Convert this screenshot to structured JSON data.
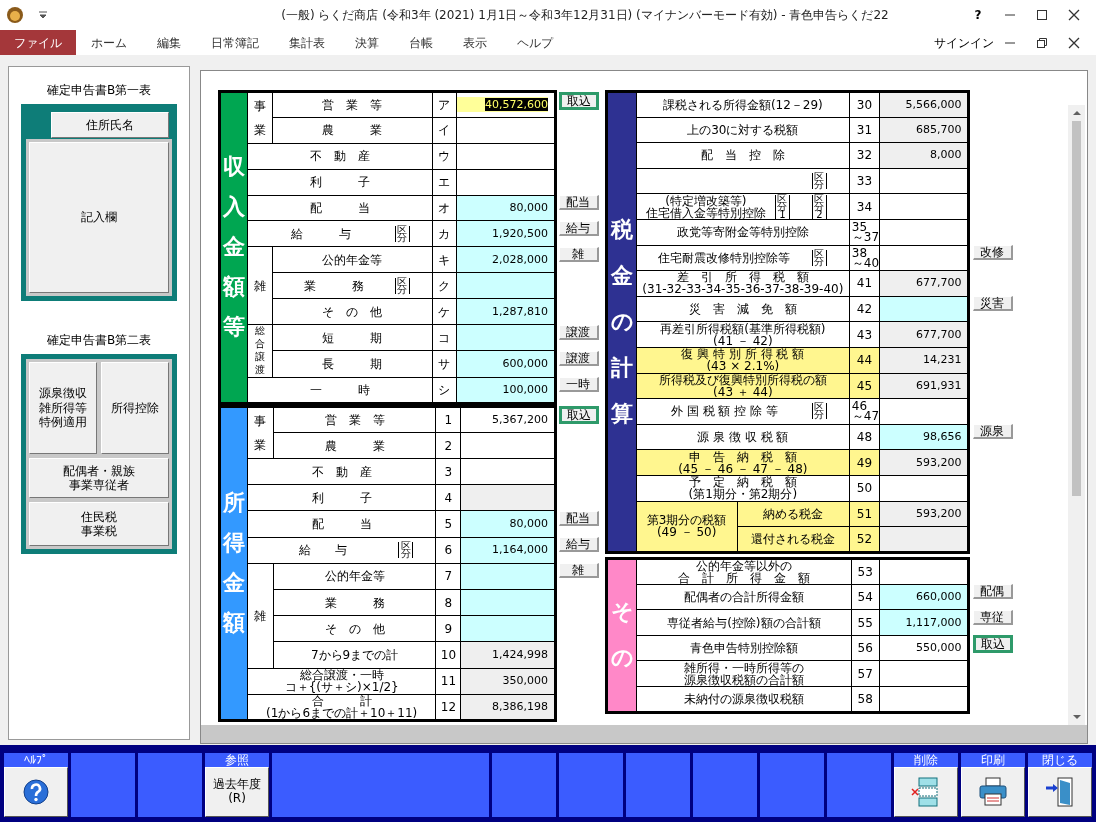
{
  "window": {
    "title": "(一般) らくだ商店 (令和3年 (2021) 1月1日～令和3年12月31日) (マイナンバーモード有効)  - 青色申告らくだ22",
    "help": "?"
  },
  "menu": {
    "tabs": [
      {
        "label": "ファイル",
        "selected": true
      },
      {
        "label": "ホーム",
        "selected": false
      },
      {
        "label": "編集",
        "selected": false
      },
      {
        "label": "日常簿記",
        "selected": false
      },
      {
        "label": "集計表",
        "selected": false
      },
      {
        "label": "決算",
        "selected": false
      },
      {
        "label": "台帳",
        "selected": false
      },
      {
        "label": "表示",
        "selected": false
      },
      {
        "label": "ヘルプ",
        "selected": false
      }
    ],
    "signin": "サインイン"
  },
  "side_panels": [
    {
      "title": "確定申告書B第一表",
      "buttons": [
        {
          "lines": [
            "住所氏名"
          ]
        },
        {
          "lines": [
            "記入欄"
          ]
        }
      ]
    },
    {
      "title": "確定申告書B第二表",
      "buttons": [
        {
          "lines": [
            "源泉徴収",
            "雑所得等",
            "特例適用"
          ]
        },
        {
          "lines": [
            "所得控除"
          ]
        },
        {
          "lines": [
            "配偶者・親族",
            "事業専従者"
          ]
        },
        {
          "lines": [
            "住民税",
            "事業税"
          ]
        }
      ]
    }
  ],
  "left_sections": [
    {
      "title": "収入金額等",
      "color": "#00a651",
      "rows": [
        {
          "label": "事業",
          "children": [
            {
              "label": "営　業　等",
              "code": "ア",
              "value": "40,572,600",
              "kind": "focused",
              "button": {
                "label": "取込",
                "kind": "highlight"
              }
            },
            {
              "label": "農　　　業",
              "code": "イ",
              "kind": "plain"
            }
          ]
        },
        {
          "label": "不　動　産",
          "code": "ウ",
          "kind": "plain"
        },
        {
          "label": "利　　　子",
          "code": "エ",
          "kind": "plain"
        },
        {
          "label": "配　　　当",
          "code": "オ",
          "value": "80,000",
          "kind": "input",
          "button": {
            "label": "配当",
            "kind": "plain"
          }
        },
        {
          "label": "給　　　与",
          "kubun": [
            "区分"
          ],
          "code": "カ",
          "value": "1,920,500",
          "kind": "input",
          "button": {
            "label": "給与",
            "kind": "plain"
          }
        },
        {
          "label": "雑",
          "button": {
            "label": "雑",
            "kind": "plain"
          },
          "children": [
            {
              "label": "公的年金等",
              "code": "キ",
              "value": "2,028,000",
              "kind": "input"
            },
            {
              "label": "業　　　務",
              "kubun": [
                "区分"
              ],
              "code": "ク",
              "kind": "input"
            },
            {
              "label": "そ　の　他",
              "code": "ケ",
              "value": "1,287,810",
              "kind": "input"
            }
          ]
        },
        {
          "label": "総合譲渡",
          "children": [
            {
              "label": "短　　　期",
              "code": "コ",
              "kind": "input",
              "button": {
                "label": "譲渡",
                "kind": "plain"
              }
            },
            {
              "label": "長　　　期",
              "code": "サ",
              "value": "600,000",
              "kind": "input",
              "button": {
                "label": "譲渡",
                "kind": "plain"
              }
            }
          ]
        },
        {
          "label": "一　　　時",
          "code": "シ",
          "value": "100,000",
          "kind": "input",
          "button": {
            "label": "一時",
            "kind": "plain"
          }
        }
      ]
    },
    {
      "title": "所得金額",
      "color": "#3399ff",
      "rows": [
        {
          "label": "事業",
          "children": [
            {
              "label": "営　業　等",
              "code": "1",
              "value": "5,367,200",
              "kind": "plain",
              "button": {
                "label": "取込",
                "kind": "highlight"
              }
            },
            {
              "label": "農　　　業",
              "code": "2",
              "kind": "plain"
            }
          ]
        },
        {
          "label": "不　動　産",
          "code": "3",
          "kind": "plain"
        },
        {
          "label": "利　　　子",
          "code": "4",
          "kind": "calc"
        },
        {
          "label": "配　　　当",
          "code": "5",
          "value": "80,000",
          "kind": "input",
          "button": {
            "label": "配当",
            "kind": "plain"
          }
        },
        {
          "label": "給　　与",
          "kubun": [
            "区分"
          ],
          "code": "6",
          "value": "1,164,000",
          "kind": "input",
          "button": {
            "label": "給与",
            "kind": "plain"
          }
        },
        {
          "label": "雑",
          "button": {
            "label": "雑",
            "kind": "plain"
          },
          "children": [
            {
              "label": "公的年金等",
              "code": "7",
              "kind": "input"
            },
            {
              "label": "業　　　務",
              "code": "8",
              "kind": "input"
            },
            {
              "label": "そ　の　他",
              "code": "9",
              "kind": "input"
            },
            {
              "label": "7から9までの計",
              "code": "10",
              "value": "1,424,998",
              "kind": "calc"
            }
          ]
        },
        {
          "label": "総合譲渡・一時",
          "note": "コ＋{(サ＋シ)×1/2}",
          "code": "11",
          "value": "350,000",
          "kind": "calc"
        },
        {
          "label": "合　　　計",
          "note": "(1から6までの計＋10＋11)",
          "code": "12",
          "value": "8,386,198",
          "kind": "calc"
        }
      ]
    }
  ],
  "right_sections": [
    {
      "title": "税金の計算",
      "color": "#2e3192",
      "rows": [
        {
          "label": "課税される所得金額(12－29)",
          "code": "30",
          "value": "5,566,000",
          "kind": "calc",
          "highlight": false
        },
        {
          "label": "上の30に対する税額",
          "code": "31",
          "value": "685,700",
          "kind": "calc",
          "highlight": false
        },
        {
          "label": "配　当　控　除",
          "code": "32",
          "value": "8,000",
          "kind": "calc",
          "highlight": false
        },
        {
          "kubun": [
            "区分"
          ],
          "code": "33",
          "kind": "plain",
          "highlight": false
        },
        {
          "label": "(特定増改築等)",
          "note": "住宅借入金等特別控除",
          "kubun": [
            "区分1",
            "区分2"
          ],
          "code": "34",
          "kind": "plain",
          "highlight": false
        },
        {
          "label": "政党等寄附金等特別控除",
          "code": "35～37",
          "kind": "plain",
          "highlight": false
        },
        {
          "label": "住宅耐震改修特別控除等",
          "kubun": [
            "区分"
          ],
          "code": "38～40",
          "kind": "plain",
          "highlight": false,
          "button": {
            "label": "改修",
            "kind": "plain"
          }
        },
        {
          "label": "差　引　所　得　税　額",
          "note": "(31-32-33-34-35-36-37-38-39-40)",
          "code": "41",
          "value": "677,700",
          "kind": "calc",
          "highlight": false
        },
        {
          "label": "災　害　減　免　額",
          "code": "42",
          "kind": "input",
          "highlight": false,
          "button": {
            "label": "災害",
            "kind": "plain"
          }
        },
        {
          "label": "再差引所得税額(基準所得税額)",
          "note": "(41 － 42)",
          "code": "43",
          "value": "677,700",
          "kind": "calc",
          "highlight": false
        },
        {
          "label": "復 興 特 別 所 得 税 額",
          "note": "(43 × 2.1%)",
          "code": "44",
          "value": "14,231",
          "kind": "calc",
          "highlight": true
        },
        {
          "label": "所得税及び復興特別所得税の額",
          "note": "(43 ＋ 44)",
          "code": "45",
          "value": "691,931",
          "kind": "calc",
          "highlight": true
        },
        {
          "label": "外 国 税 額 控 除 等",
          "kubun": [
            "区分"
          ],
          "code": "46～47",
          "kind": "plain",
          "highlight": false
        },
        {
          "label": "源 泉 徴 収 税 額",
          "code": "48",
          "value": "98,656",
          "kind": "input",
          "highlight": false,
          "button": {
            "label": "源泉",
            "kind": "plain"
          }
        },
        {
          "label": "申　告　納　税　額",
          "note": "(45 － 46 － 47 － 48)",
          "code": "49",
          "value": "593,200",
          "kind": "calc",
          "highlight": true
        },
        {
          "label": "予　定　納　税　額",
          "note": "(第1期分・第2期分)",
          "code": "50",
          "kind": "plain",
          "highlight": false
        },
        {
          "label": "第3期分の税額",
          "note": "(49 － 50)",
          "highlight": true,
          "children": [
            {
              "label": "納める税金",
              "code": "51",
              "value": "593,200",
              "kind": "calc",
              "highlight": true
            },
            {
              "label": "還付される税金",
              "code": "52",
              "kind": "calc",
              "highlight": true
            }
          ]
        }
      ]
    },
    {
      "title": "その",
      "color": "#ff88c8",
      "rows": [
        {
          "label": "公的年金等以外の",
          "note": "合　計　所　得　金　額",
          "code": "53",
          "kind": "plain",
          "highlight": false
        },
        {
          "label": "配偶者の合計所得金額",
          "code": "54",
          "value": "660,000",
          "kind": "input",
          "highlight": false,
          "button": {
            "label": "配偶",
            "kind": "plain"
          }
        },
        {
          "label": "専従者給与(控除)額の合計額",
          "code": "55",
          "value": "1,117,000",
          "kind": "input",
          "highlight": false,
          "button": {
            "label": "専従",
            "kind": "plain"
          }
        },
        {
          "label": "青色申告特別控除額",
          "code": "56",
          "value": "550,000",
          "kind": "plain",
          "highlight": false,
          "button": {
            "label": "取込",
            "kind": "highlight"
          }
        },
        {
          "label": "雑所得・一時所得等の",
          "note": "源泉徴収税額の合計額",
          "code": "57",
          "kind": "plain",
          "highlight": false
        },
        {
          "label": "未納付の源泉徴収税額",
          "code": "58",
          "kind": "plain",
          "highlight": false
        }
      ]
    }
  ],
  "toolbar": [
    {
      "kind": "help",
      "header": "ﾍﾙﾌﾟ"
    },
    {
      "kind": "empty"
    },
    {
      "kind": "empty"
    },
    {
      "kind": "text",
      "header": "参照",
      "label": "過去年度",
      "accel": "(R)"
    },
    {
      "kind": "empty"
    },
    {
      "kind": "empty"
    },
    {
      "kind": "empty"
    },
    {
      "kind": "empty"
    },
    {
      "kind": "empty"
    },
    {
      "kind": "empty"
    },
    {
      "kind": "empty"
    },
    {
      "kind": "delete",
      "header": "削除"
    },
    {
      "kind": "print",
      "header": "印刷"
    },
    {
      "kind": "exit",
      "header": "閉じる"
    }
  ]
}
